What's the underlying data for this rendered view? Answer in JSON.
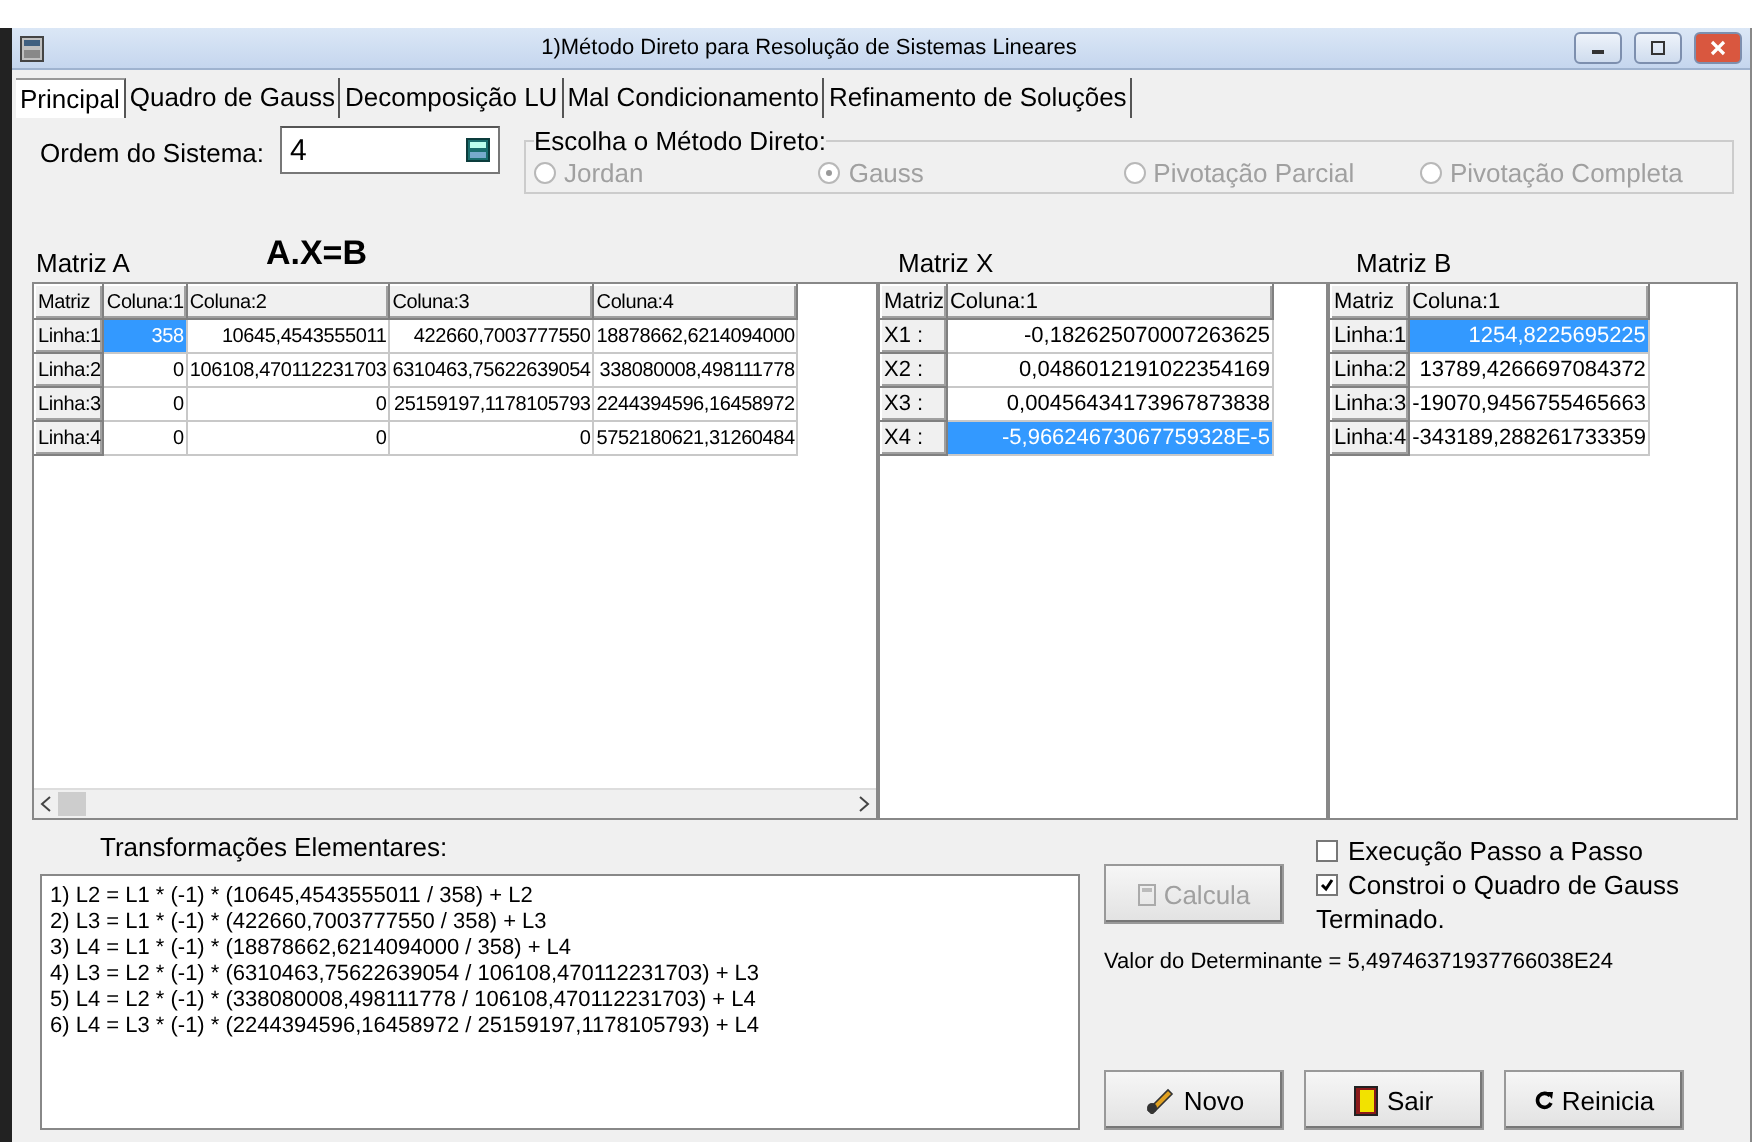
{
  "window": {
    "title": "1)Método Direto para Resolução de Sistemas Lineares"
  },
  "tabs": [
    {
      "label": "Principal",
      "selected": true
    },
    {
      "label": "Quadro de Gauss",
      "selected": false
    },
    {
      "label": "Decomposição LU",
      "selected": false
    },
    {
      "label": "Mal Condicionamento",
      "selected": false
    },
    {
      "label": "Refinamento de Soluções",
      "selected": false
    }
  ],
  "order": {
    "label": "Ordem do Sistema:",
    "value": "4"
  },
  "method_group": {
    "title": "Escolha o Método Direto:",
    "options": [
      {
        "label": "Jordan",
        "selected": false,
        "disabled": true
      },
      {
        "label": "Gauss",
        "selected": true,
        "disabled": true
      },
      {
        "label": "Pivotação Parcial",
        "selected": false,
        "disabled": true
      },
      {
        "label": "Pivotação Completa",
        "selected": false,
        "disabled": true
      }
    ]
  },
  "equation": "A.X=B",
  "matrices": [
    {
      "title": "Matriz A",
      "corner": "Matriz",
      "columns": [
        "Coluna:1",
        "Coluna:2",
        "Coluna:3",
        "Coluna:4"
      ],
      "hscroll": true,
      "rows": [
        {
          "header": "Linha:1",
          "cells": [
            {
              "text": "358",
              "selected": true
            },
            {
              "text": "10645,4543555011",
              "selected": false
            },
            {
              "text": "422660,7003777550",
              "selected": false
            },
            {
              "text": "18878662,6214094000",
              "selected": false
            }
          ]
        },
        {
          "header": "Linha:2",
          "cells": [
            {
              "text": "0",
              "selected": false
            },
            {
              "text": "106108,470112231703",
              "selected": false
            },
            {
              "text": "6310463,75622639054",
              "selected": false
            },
            {
              "text": "338080008,498111778",
              "selected": false
            }
          ]
        },
        {
          "header": "Linha:3",
          "cells": [
            {
              "text": "0",
              "selected": false
            },
            {
              "text": "0",
              "selected": false
            },
            {
              "text": "25159197,1178105793",
              "selected": false
            },
            {
              "text": "2244394596,16458972",
              "selected": false
            }
          ]
        },
        {
          "header": "Linha:4",
          "cells": [
            {
              "text": "0",
              "selected": false
            },
            {
              "text": "0",
              "selected": false
            },
            {
              "text": "0",
              "selected": false
            },
            {
              "text": "5752180621,31260484",
              "selected": false
            }
          ]
        }
      ]
    },
    {
      "title": "Matriz X",
      "corner": "Matriz",
      "columns": [
        "Coluna:1"
      ],
      "hscroll": false,
      "rows": [
        {
          "header": "X1 :",
          "cells": [
            {
              "text": "-0,182625070007263625",
              "selected": false
            }
          ]
        },
        {
          "header": "X2 :",
          "cells": [
            {
              "text": "0,0486012191022354169",
              "selected": false
            }
          ]
        },
        {
          "header": "X3 :",
          "cells": [
            {
              "text": "0,00456434173967873838",
              "selected": false
            }
          ]
        },
        {
          "header": "X4 :",
          "cells": [
            {
              "text": "-5,96624673067759328E-5",
              "selected": true
            }
          ]
        }
      ]
    },
    {
      "title": "Matriz B",
      "corner": "Matriz",
      "columns": [
        "Coluna:1"
      ],
      "hscroll": false,
      "rows": [
        {
          "header": "Linha:1",
          "cells": [
            {
              "text": "1254,8225695225",
              "selected": true
            }
          ]
        },
        {
          "header": "Linha:2",
          "cells": [
            {
              "text": "13789,4266697084372",
              "selected": false
            }
          ]
        },
        {
          "header": "Linha:3",
          "cells": [
            {
              "text": "-19070,9456755465663",
              "selected": false
            }
          ]
        },
        {
          "header": "Linha:4",
          "cells": [
            {
              "text": "-343189,288261733359",
              "selected": false
            }
          ]
        }
      ]
    }
  ],
  "transformations": {
    "label": "Transformações Elementares:",
    "lines": [
      "1) L2 = L1 * (-1) * (10645,4543555011 / 358) + L2",
      "2) L3 = L1 * (-1) * (422660,7003777550 / 358) + L3",
      "3) L4 = L1 * (-1) * (18878662,6214094000 / 358) + L4",
      "4) L3 = L2 * (-1) * (6310463,75622639054 / 106108,470112231703) + L3",
      "5) L4 = L2 * (-1) * (338080008,498111778 / 106108,470112231703) + L4",
      "6) L4 = L3 * (-1) * (2244394596,16458972 / 25159197,1178105793) + L4"
    ]
  },
  "calculate_button": {
    "label": "Calcula",
    "disabled": true
  },
  "options": [
    {
      "label": "Execução Passo a Passo",
      "checked": false
    },
    {
      "label": "Constroi o Quadro de Gauss",
      "checked": true
    }
  ],
  "status": "Terminado.",
  "determinant": "Valor do Determinante = 5,49746371937766038E24",
  "buttons": [
    {
      "kind": "new",
      "label": "Novo"
    },
    {
      "kind": "exit",
      "label": "Sair"
    },
    {
      "kind": "restart",
      "label": "Reinicia"
    }
  ]
}
